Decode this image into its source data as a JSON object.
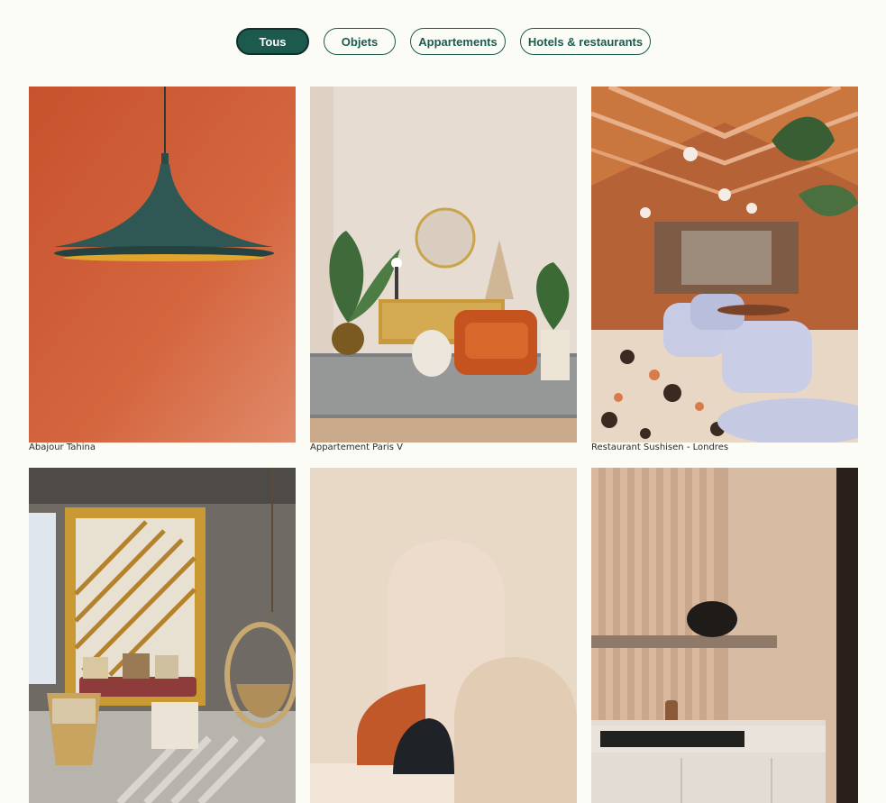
{
  "filters": {
    "all": "Tous",
    "objects": "Objets",
    "apartments": "Appartements",
    "hotels": "Hotels & restaurants"
  },
  "gallery": [
    {
      "caption": "Abajour Tahina"
    },
    {
      "caption": "Appartement Paris V"
    },
    {
      "caption": "Restaurant Sushisen - Londres"
    },
    {
      "caption": ""
    },
    {
      "caption": ""
    },
    {
      "caption": ""
    }
  ],
  "colors": {
    "accent": "#1d5a4e",
    "background": "#fcfcf7"
  }
}
